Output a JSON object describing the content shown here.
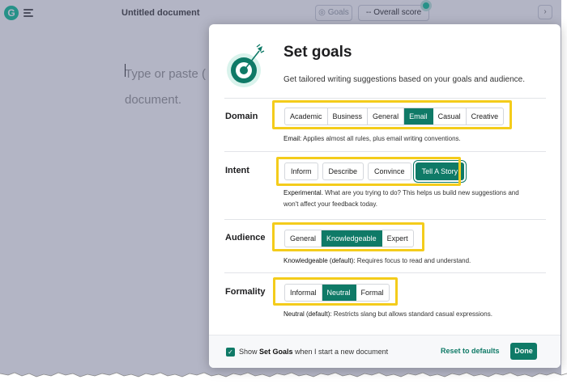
{
  "app": {
    "logo_letter": "G",
    "document_title": "Untitled document",
    "goals_button": "Goals",
    "overall_score": "Overall score",
    "score_prefix": "--",
    "editor_placeholder_line1": "Type or paste (",
    "editor_placeholder_line2": "document.",
    "collapse_glyph": "›"
  },
  "modal": {
    "title": "Set goals",
    "subtitle": "Get tailored writing suggestions based on your goals and audience.",
    "domain": {
      "label": "Domain",
      "options": [
        "Academic",
        "Business",
        "General",
        "Email",
        "Casual",
        "Creative"
      ],
      "selected": "Email",
      "description_prefix": "Email:",
      "description": " Applies almost all rules, plus email writing conventions."
    },
    "intent": {
      "label": "Intent",
      "options": [
        "Inform",
        "Describe",
        "Convince",
        "Tell A Story"
      ],
      "selected": "Tell A Story",
      "description_prefix": "Experimental.",
      "description_line1": " What are you trying to do? This helps us build new suggestions and",
      "description_line2": "won't affect your feedback today."
    },
    "audience": {
      "label": "Audience",
      "options": [
        "General",
        "Knowledgeable",
        "Expert"
      ],
      "selected": "Knowledgeable",
      "description_prefix": "Knowledgeable (default):",
      "description": " Requires focus to read and understand."
    },
    "formality": {
      "label": "Formality",
      "options": [
        "Informal",
        "Neutral",
        "Formal"
      ],
      "selected": "Neutral",
      "description_prefix": "Neutral (default):",
      "description": " Restricts slang but allows standard casual expressions."
    },
    "footer": {
      "show_prefix": "Show ",
      "show_bold": "Set Goals",
      "show_suffix": " when I start a new document",
      "checked": true,
      "reset_label": "Reset to defaults",
      "done_label": "Done"
    }
  },
  "colors": {
    "accent": "#0f7a67",
    "brand_green": "#15c39a",
    "highlight": "#f4cc1b"
  },
  "icons": {
    "logo": "grammarly-logo-icon",
    "menu": "menu-icon",
    "goals": "goals-icon",
    "target": "target-arrow-icon",
    "checkbox": "checkmark-icon",
    "cursor": "mouse-pointer-icon"
  }
}
